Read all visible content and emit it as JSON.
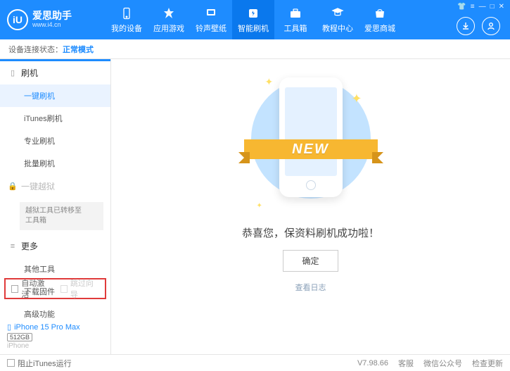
{
  "brand": {
    "name": "爱思助手",
    "url": "www.i4.cn",
    "mark": "iU"
  },
  "nav": [
    {
      "label": "我的设备"
    },
    {
      "label": "应用游戏"
    },
    {
      "label": "铃声壁纸"
    },
    {
      "label": "智能刷机"
    },
    {
      "label": "工具箱"
    },
    {
      "label": "教程中心"
    },
    {
      "label": "爱思商城"
    }
  ],
  "statusbar": {
    "label": "设备连接状态：",
    "value": "正常模式"
  },
  "sidebar": {
    "group1": {
      "head": "刷机",
      "items": [
        "一键刷机",
        "iTunes刷机",
        "专业刷机",
        "批量刷机"
      ]
    },
    "group2": {
      "head": "一键越狱",
      "note": "越狱工具已转移至\n工具箱"
    },
    "group3": {
      "head": "更多",
      "items": [
        "其他工具",
        "下载固件",
        "高级功能"
      ]
    },
    "checks": {
      "auto_activate": "自动激活",
      "skip_setup": "跳过向导"
    },
    "device": {
      "name": "iPhone 15 Pro Max",
      "storage": "512GB",
      "type": "iPhone"
    }
  },
  "main": {
    "ribbon": "NEW",
    "success": "恭喜您，保资料刷机成功啦！",
    "ok": "确定",
    "log": "查看日志"
  },
  "footer": {
    "block_itunes": "阻止iTunes运行",
    "version": "V7.98.66",
    "links": [
      "客服",
      "微信公众号",
      "检查更新"
    ]
  }
}
